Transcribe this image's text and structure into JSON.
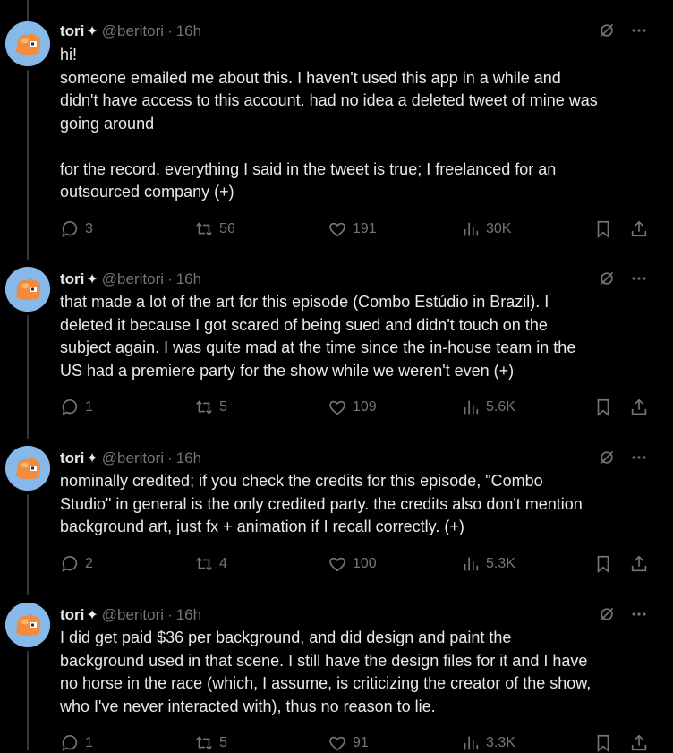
{
  "icons": {
    "reply": "reply-icon",
    "retweet": "retweet-icon",
    "like": "heart-icon",
    "views": "views-icon",
    "bookmark": "bookmark-icon",
    "share": "share-icon",
    "grok": "grok-icon",
    "more": "more-icon"
  },
  "tweets": [
    {
      "author": {
        "name": "tori",
        "badge": "✦",
        "handle": "@beritori",
        "sep": "·",
        "time": "16h"
      },
      "lines": [
        "hi!",
        "someone emailed me about this. I haven't used this app in a while and",
        "didn't have access to this account. had no idea a deleted tweet of mine was",
        "going around",
        "",
        "for the record, everything I said in the tweet is true; I freelanced for an",
        "outsourced company (+)"
      ],
      "stats": {
        "replies": "3",
        "retweets": "56",
        "likes": "191",
        "views": "30K"
      }
    },
    {
      "author": {
        "name": "tori",
        "badge": "✦",
        "handle": "@beritori",
        "sep": "·",
        "time": "16h"
      },
      "lines": [
        "that made a lot of the art for this episode (Combo Estúdio in Brazil). I",
        "deleted it because I got scared of being sued and didn't touch on the",
        "subject again. I was quite mad at the time since the in-house team in the",
        "US had a premiere party for the show while we weren't even (+)"
      ],
      "stats": {
        "replies": "1",
        "retweets": "5",
        "likes": "109",
        "views": "5.6K"
      }
    },
    {
      "author": {
        "name": "tori",
        "badge": "✦",
        "handle": "@beritori",
        "sep": "·",
        "time": "16h"
      },
      "lines": [
        "nominally credited; if you check the credits for this episode, \"Combo",
        "Studio\" in general is the only credited party. the credits also don't mention",
        "background art, just fx + animation if I recall correctly. (+)"
      ],
      "stats": {
        "replies": "2",
        "retweets": "4",
        "likes": "100",
        "views": "5.3K"
      }
    },
    {
      "author": {
        "name": "tori",
        "badge": "✦",
        "handle": "@beritori",
        "sep": "·",
        "time": "16h"
      },
      "lines": [
        "I did get paid $36 per background, and did design and paint the",
        "background used in that scene. I still have the design files for it and I have",
        "no horse in the race (which, I assume, is criticizing the creator of the show,",
        "who I've never interacted with), thus no reason to lie."
      ],
      "stats": {
        "replies": "1",
        "retweets": "5",
        "likes": "91",
        "views": "3.3K"
      }
    }
  ]
}
